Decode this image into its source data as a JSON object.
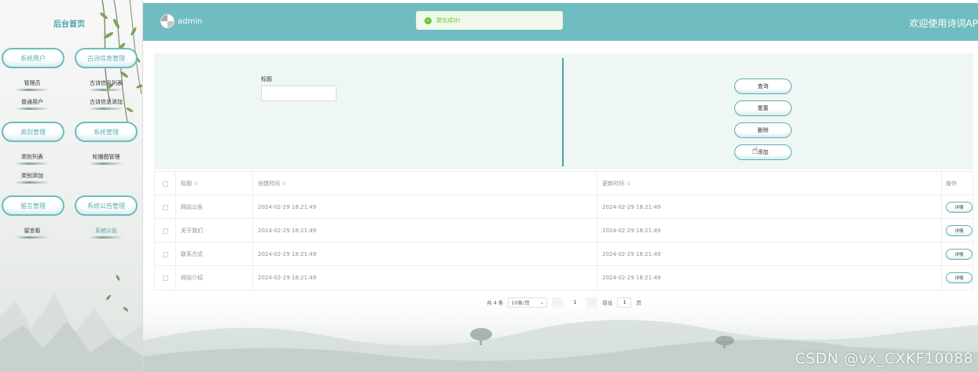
{
  "sidebar": {
    "home": "后台首页",
    "groups": [
      {
        "label": "系统用户",
        "items": [
          "管理员",
          "普通用户"
        ]
      },
      {
        "label": "古诗信息管理",
        "items": [
          "古诗信息列表",
          "古诗信息添加"
        ]
      },
      {
        "label": "类别管理",
        "items": [
          "类别列表",
          "类别添加"
        ]
      },
      {
        "label": "系统管理",
        "items": [
          "轮播图管理"
        ]
      },
      {
        "label": "留言管理",
        "items": [
          "留言板"
        ]
      },
      {
        "label": "系统公告管理",
        "items": [
          "系统公告"
        ]
      }
    ]
  },
  "header": {
    "username": "admin",
    "welcome": "欢迎使用诗词AP",
    "toast": "提交成功!",
    "bg_color": "#6fbcc1"
  },
  "search": {
    "title_label": "标题",
    "title_value": "",
    "buttons": {
      "query": "查询",
      "reset": "重置",
      "delete": "删除",
      "add": "添加"
    }
  },
  "table": {
    "headers": {
      "title": "标题",
      "created": "创建时间",
      "updated": "更新时间",
      "ops": "操作"
    },
    "rows": [
      {
        "title": "网站公告",
        "created": "2024-02-29 18:21:49",
        "updated": "2024-02-29 18:21:49",
        "action": "详情"
      },
      {
        "title": "关于我们",
        "created": "2024-02-29 18:21:49",
        "updated": "2024-02-29 18:21:49",
        "action": "详情"
      },
      {
        "title": "联系方式",
        "created": "2024-02-29 18:21:49",
        "updated": "2024-02-29 18:21:49",
        "action": "详情"
      },
      {
        "title": "网站介绍",
        "created": "2024-02-29 18:21:49",
        "updated": "2024-02-29 18:21:49",
        "action": "详情"
      }
    ]
  },
  "pagination": {
    "total": "共 4 条",
    "page_size": "10条/页",
    "current_page": "1",
    "goto_label": "前往",
    "goto_value": "1",
    "page_unit": "页"
  },
  "watermark": "CSDN @vx_CXKF10088",
  "colors": {
    "accent": "#6fbcc1",
    "success": "#67c23a",
    "panel": "#eef7f4"
  }
}
